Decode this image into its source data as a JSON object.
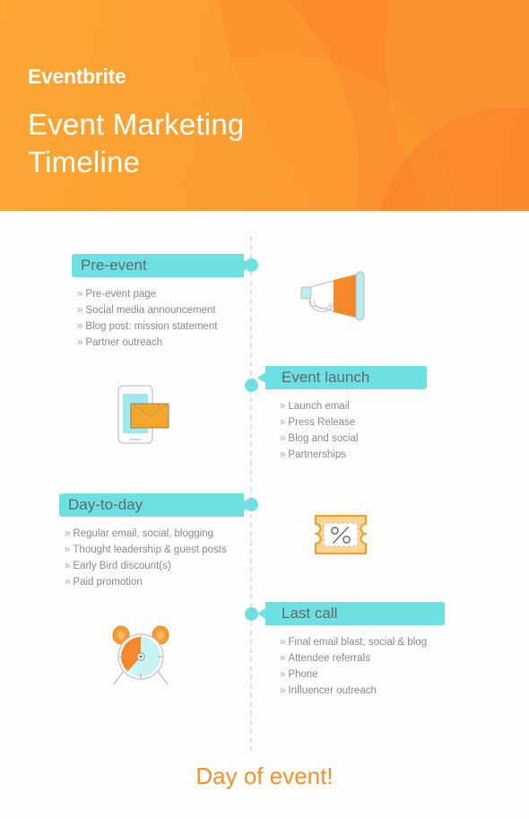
{
  "header": {
    "brand": "Eventbrite",
    "title_line1": "Event Marketing",
    "title_line2": "Timeline",
    "bg_color_start": "#faa634",
    "bg_color_end": "#f9822b"
  },
  "theme": {
    "accent_cyan": "#6edfe2",
    "accent_orange": "#f79027",
    "body_bg": "#fdfdfd",
    "list_text": "#8b8b8b",
    "label_text": "#5e6b6b",
    "dash_line": "#e2e2e2"
  },
  "timeline": {
    "sections": [
      {
        "label": "Pre-event",
        "side": "left",
        "icon": "megaphone-icon",
        "items": [
          "Pre-event page",
          "Social media announcement",
          "Blog post: mission statement",
          "Partner outreach"
        ]
      },
      {
        "label": "Event launch",
        "side": "right",
        "icon": "phone-email-icon",
        "items": [
          "Launch email",
          "Press Release",
          "Blog and social",
          "Partnerships"
        ]
      },
      {
        "label": "Day-to-day",
        "side": "left",
        "icon": "discount-ticket-icon",
        "items": [
          "Regular email, social, blogging",
          "Thought leadership & guest posts",
          "Early Bird discount(s)",
          "Paid promotion"
        ]
      },
      {
        "label": "Last call",
        "side": "right",
        "icon": "alarm-clock-icon",
        "items": [
          "Final email blast, social & blog",
          "Attendee referrals",
          "Phone",
          "Influencer outreach"
        ]
      }
    ],
    "bullet_glyph": "»"
  },
  "footer": {
    "text": "Day of event!"
  }
}
